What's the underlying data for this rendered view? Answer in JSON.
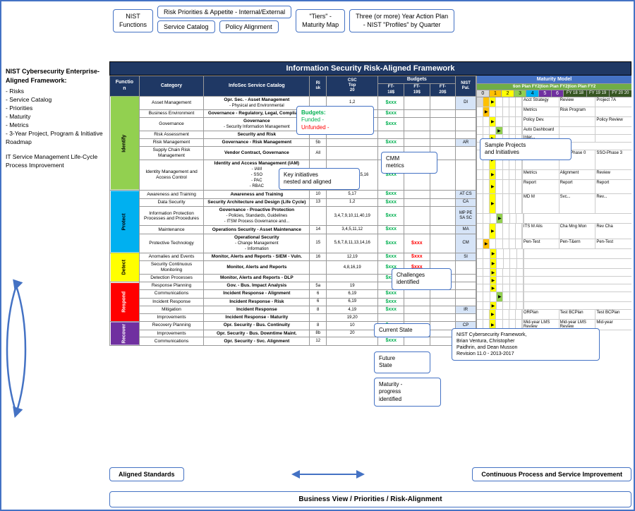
{
  "title": "Information Security Risk-Aligned Framework",
  "top_header": {
    "nist_functions": "NIST\nFunctions",
    "risk_priorities": "Risk Priorities & Appetite - Internal/External",
    "service_catalog": "Service Catalog",
    "policy_alignment": "Policy Alignment",
    "tiers": "\"Tiers\" -\nMaturity Map",
    "action_plan": "Three (or more) Year Action Plan\n- NIST \"Profiles\" by Quarter"
  },
  "left_framework": {
    "title": "NIST Cybersecurity Enterprise-Aligned Framework:",
    "items": [
      "- Risks",
      "- Service Catalog",
      "- Priorities",
      "- Maturity",
      "- Metrics",
      "- 3-Year Project, Program & Initiative Roadmap"
    ],
    "subtitle": "IT Service Management Life-Cycle Process Improvement"
  },
  "callouts": {
    "budgets": "Budgets:\nFunded -\nUnfunded -",
    "cmm_metrics": "CMM\nmetrics",
    "key_initiatives": "Key initiatives\nnested and aligned",
    "challenges": "Challenges\nidentified",
    "current_state": "Current State",
    "future_state": "Future\nState",
    "maturity": "Maturity -\nprogress\nidentified",
    "sample_projects": "Sample Projects\nand Initiatives",
    "nist_ref": "NIST Cybersecurity Framework,\nBrian Ventura, Christopher\nPaidhrin, and Dean Musson\nRevision 11.0 - 2013-2017"
  },
  "bottom": {
    "aligned_standards": "Aligned Standards",
    "continuous_improvement": "Continuous Process and Service Improvement",
    "business_view": "Business View / Priorities / Risk-Alignment"
  },
  "table": {
    "columns": [
      "Function",
      "Category",
      "InfoSec Service Catalog",
      "Risk",
      "CSC Top 20",
      "FT-18$",
      "FT-19$",
      "FT-20$",
      "NIST Pal.",
      "0",
      "1",
      "2",
      "3",
      "4",
      "5",
      "6"
    ],
    "rows": [
      {
        "function": "Identify",
        "category": "Asset Management",
        "service": "Opr. Sec. - Asset Management\n- Physical and Environmental",
        "risk": "",
        "csc": "1,2",
        "ft18": "$xxx",
        "nist": "DI",
        "maturity": 2
      },
      {
        "function": "",
        "category": "Business Environment",
        "service": "Governance - Regulatory, Legal, Compliance",
        "risk": "7",
        "csc": "",
        "ft18": "$xxx",
        "nist": "",
        "maturity": 1
      },
      {
        "function": "",
        "category": "Governance",
        "service": "Governance\n- Security Information Management",
        "risk": "5",
        "csc": "4",
        "ft18": "$xxx",
        "nist": "",
        "maturity": 2
      },
      {
        "function": "",
        "category": "Risk Assessment",
        "service": "Security and Risk",
        "risk": "5a",
        "csc": "4",
        "ft18": "",
        "nist": "",
        "maturity": 3
      },
      {
        "function": "",
        "category": "Risk Management",
        "service": "Governance - Risk Management",
        "risk": "5b",
        "csc": "",
        "ft18": "$xxx",
        "nist": "AR",
        "maturity": 2
      },
      {
        "function": "",
        "category": "Supply Chain Risk Management",
        "service": "Vendor Contract, Governance",
        "risk": "All",
        "csc": "",
        "ft18": "",
        "nist": "",
        "maturity": 1
      },
      {
        "function": "",
        "category": "Identity and Access Management",
        "service": "Identity and Access Management (IAM)\n- IAM\n- SSO\n- PAC\n- RBAC",
        "risk": "5,9",
        "csc": "2,3,4,11,12,15,16",
        "ft18": "$xxx",
        "nist": "",
        "maturity": 2
      },
      {
        "function": "",
        "category": "Awareness and Training",
        "service": "Awareness and Training",
        "risk": "10",
        "csc": "5,17",
        "ft18": "$xxx",
        "nist": "AT CS",
        "maturity": 2
      },
      {
        "function": "Protect",
        "category": "Data Security",
        "service": "Security Architecture and Design (Life Cycle)",
        "risk": "13",
        "csc": "1,2",
        "ft18": "$xxx",
        "nist": "CA",
        "maturity": 2
      },
      {
        "function": "",
        "category": "Information Protection Processes and Procedures",
        "service": "Governance - Proactive Protection\n- Policies, Standards, Guidelines\n- ITSM Process Governance and...",
        "risk": "",
        "csc": "3,4,7,9,10,11,40,19",
        "ft18": "$xxx",
        "nist": "MP PE SA SC",
        "maturity": 2
      },
      {
        "function": "",
        "category": "Maintenance",
        "service": "Operations Security - Asset Maintenance",
        "risk": "14",
        "csc": "3,4,5,11,12",
        "ft18": "$xxx",
        "nist": "MA",
        "maturity": 3
      },
      {
        "function": "",
        "category": "Protective Technology",
        "service": "Operational Security\n- Change Management\n- Information",
        "risk": "15",
        "csc": "5,6,7,8,11,13,14,16",
        "ft18": "$xxx",
        "nist": "CM",
        "maturity": 2
      },
      {
        "function": "Detect",
        "category": "Anomalies and Events",
        "service": "Monitor, Alerts and Reports - SIEM - Vuln.",
        "risk": "16",
        "csc": "12,19",
        "ft18": "$xxx",
        "nist": "SI",
        "maturity": 1
      },
      {
        "function": "",
        "category": "Security Continuous Monitoring",
        "service": "Monitor, Alerts and Reports",
        "risk": "",
        "csc": "4,8,16,19",
        "ft18": "$xxx",
        "nist": "",
        "maturity": 2
      },
      {
        "function": "",
        "category": "Detection Processes",
        "service": "Monitor, Alerts and Reports - DLP",
        "risk": "",
        "csc": "",
        "ft18": "$xxx",
        "nist": "",
        "maturity": 2
      },
      {
        "function": "Respond",
        "category": "Response Planning",
        "service": "Gov. - Bus. Impact Analysis",
        "risk": "5a",
        "csc": "19",
        "ft18": "",
        "nist": "",
        "maturity": 2
      },
      {
        "function": "",
        "category": "Communications",
        "service": "Incident Response - Alignment",
        "risk": "6",
        "csc": "6,19",
        "ft18": "$xxx",
        "nist": "",
        "maturity": 2
      },
      {
        "function": "",
        "category": "Incident Response",
        "service": "Incident Response - Risk",
        "risk": "6",
        "csc": "6,19",
        "ft18": "$xxx",
        "nist": "",
        "maturity": 2
      },
      {
        "function": "",
        "category": "Mitigation",
        "service": "Incident Response",
        "risk": "8",
        "csc": "4,19",
        "ft18": "$xxx",
        "nist": "IR",
        "maturity": 3
      },
      {
        "function": "",
        "category": "Improvements",
        "service": "Incident Response - Maturity",
        "risk": "",
        "csc": "19,20",
        "ft18": "",
        "nist": "",
        "maturity": 2
      },
      {
        "function": "Recover",
        "category": "Recovery Planning",
        "service": "Opr. Security - Bus. Continuity",
        "risk": "8",
        "csc": "10",
        "ft18": "$xxx",
        "nist": "CP",
        "maturity": 2
      },
      {
        "function": "",
        "category": "Improvements",
        "service": "Opr. Security - Bus. Downtime Maint.",
        "risk": "8b",
        "csc": "20",
        "ft18": "",
        "nist": "",
        "maturity": 2
      },
      {
        "function": "",
        "category": "Communications",
        "service": "Opr. Security - Svc. Alignment",
        "risk": "12",
        "csc": "",
        "ft18": "$xxx",
        "nist": "",
        "maturity": 2
      }
    ]
  }
}
